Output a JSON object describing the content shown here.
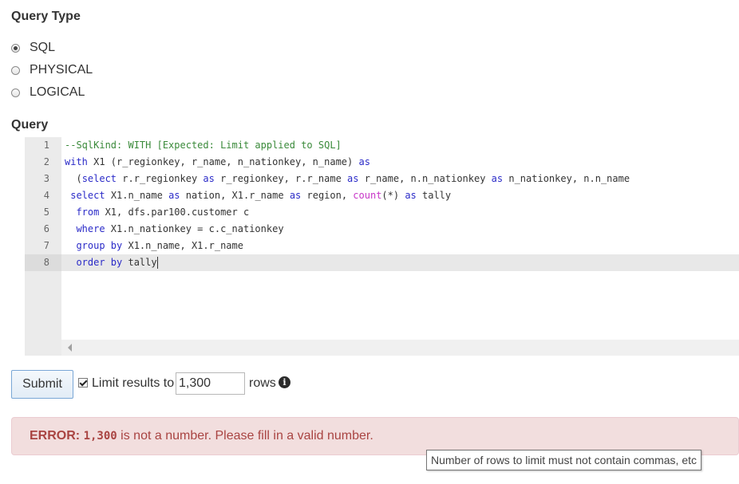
{
  "query_type": {
    "title": "Query Type",
    "options": [
      {
        "label": "SQL",
        "checked": true
      },
      {
        "label": "PHYSICAL",
        "checked": false
      },
      {
        "label": "LOGICAL",
        "checked": false
      }
    ]
  },
  "query": {
    "title": "Query",
    "line_numbers": [
      "1",
      "2",
      "3",
      "4",
      "5",
      "6",
      "7",
      "8"
    ],
    "lines": [
      [
        {
          "t": "--SqlKind: WITH [Expected: Limit applied to SQL]",
          "c": "comment"
        }
      ],
      [
        {
          "t": "with",
          "c": "kw"
        },
        {
          "t": " X1 (r_regionkey, r_name, n_nationkey, n_name) ",
          "c": ""
        },
        {
          "t": "as",
          "c": "kw"
        }
      ],
      [
        {
          "t": "  (",
          "c": ""
        },
        {
          "t": "select",
          "c": "kw"
        },
        {
          "t": " r.r_regionkey ",
          "c": ""
        },
        {
          "t": "as",
          "c": "kw"
        },
        {
          "t": " r_regionkey, r.r_name ",
          "c": ""
        },
        {
          "t": "as",
          "c": "kw"
        },
        {
          "t": " r_name, n.n_nationkey ",
          "c": ""
        },
        {
          "t": "as",
          "c": "kw"
        },
        {
          "t": " n_nationkey, n.n_name ",
          "c": ""
        }
      ],
      [
        {
          "t": " ",
          "c": ""
        },
        {
          "t": "select",
          "c": "kw"
        },
        {
          "t": " X1.n_name ",
          "c": ""
        },
        {
          "t": "as",
          "c": "kw"
        },
        {
          "t": " nation, X1.r_name ",
          "c": ""
        },
        {
          "t": "as",
          "c": "kw"
        },
        {
          "t": " region, ",
          "c": ""
        },
        {
          "t": "count",
          "c": "fn"
        },
        {
          "t": "(*) ",
          "c": ""
        },
        {
          "t": "as",
          "c": "kw"
        },
        {
          "t": " tally",
          "c": ""
        }
      ],
      [
        {
          "t": "  ",
          "c": ""
        },
        {
          "t": "from",
          "c": "kw"
        },
        {
          "t": " X1, dfs.par100.customer c",
          "c": ""
        }
      ],
      [
        {
          "t": "  ",
          "c": ""
        },
        {
          "t": "where",
          "c": "kw"
        },
        {
          "t": " X1.n_nationkey = c.c_nationkey",
          "c": ""
        }
      ],
      [
        {
          "t": "  ",
          "c": ""
        },
        {
          "t": "group by",
          "c": "kw"
        },
        {
          "t": " X1.n_name, X1.r_name",
          "c": ""
        }
      ],
      [
        {
          "t": "  ",
          "c": ""
        },
        {
          "t": "order by",
          "c": "kw"
        },
        {
          "t": " tally",
          "c": ""
        }
      ]
    ]
  },
  "controls": {
    "submit_label": "Submit",
    "limit_checked": true,
    "limit_label": "Limit results to",
    "limit_value": "1,300",
    "rows_label": "rows",
    "info_icon": "info-circle-icon"
  },
  "alert": {
    "error_prefix": "ERROR:",
    "error_value": "1,300",
    "error_message": "is not a number. Please fill in a valid number."
  },
  "tooltip": {
    "text": "Number of rows to limit must not contain commas, etc"
  },
  "colors": {
    "keyword": "#2b2bc8",
    "comment": "#3a8a3a",
    "function": "#c837c8",
    "error_text": "#a94442",
    "error_bg": "#f2dede"
  }
}
